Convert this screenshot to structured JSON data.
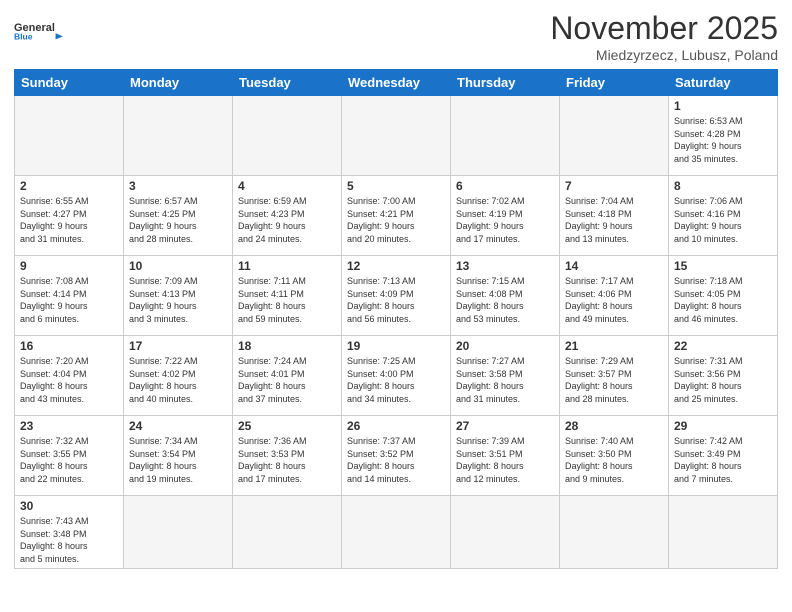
{
  "header": {
    "logo_general": "General",
    "logo_blue": "Blue",
    "month_year": "November 2025",
    "location": "Miedzyrzecz, Lubusz, Poland"
  },
  "weekdays": [
    "Sunday",
    "Monday",
    "Tuesday",
    "Wednesday",
    "Thursday",
    "Friday",
    "Saturday"
  ],
  "weeks": [
    [
      {
        "day": "",
        "info": ""
      },
      {
        "day": "",
        "info": ""
      },
      {
        "day": "",
        "info": ""
      },
      {
        "day": "",
        "info": ""
      },
      {
        "day": "",
        "info": ""
      },
      {
        "day": "",
        "info": ""
      },
      {
        "day": "1",
        "info": "Sunrise: 6:53 AM\nSunset: 4:28 PM\nDaylight: 9 hours\nand 35 minutes."
      }
    ],
    [
      {
        "day": "2",
        "info": "Sunrise: 6:55 AM\nSunset: 4:27 PM\nDaylight: 9 hours\nand 31 minutes."
      },
      {
        "day": "3",
        "info": "Sunrise: 6:57 AM\nSunset: 4:25 PM\nDaylight: 9 hours\nand 28 minutes."
      },
      {
        "day": "4",
        "info": "Sunrise: 6:59 AM\nSunset: 4:23 PM\nDaylight: 9 hours\nand 24 minutes."
      },
      {
        "day": "5",
        "info": "Sunrise: 7:00 AM\nSunset: 4:21 PM\nDaylight: 9 hours\nand 20 minutes."
      },
      {
        "day": "6",
        "info": "Sunrise: 7:02 AM\nSunset: 4:19 PM\nDaylight: 9 hours\nand 17 minutes."
      },
      {
        "day": "7",
        "info": "Sunrise: 7:04 AM\nSunset: 4:18 PM\nDaylight: 9 hours\nand 13 minutes."
      },
      {
        "day": "8",
        "info": "Sunrise: 7:06 AM\nSunset: 4:16 PM\nDaylight: 9 hours\nand 10 minutes."
      }
    ],
    [
      {
        "day": "9",
        "info": "Sunrise: 7:08 AM\nSunset: 4:14 PM\nDaylight: 9 hours\nand 6 minutes."
      },
      {
        "day": "10",
        "info": "Sunrise: 7:09 AM\nSunset: 4:13 PM\nDaylight: 9 hours\nand 3 minutes."
      },
      {
        "day": "11",
        "info": "Sunrise: 7:11 AM\nSunset: 4:11 PM\nDaylight: 8 hours\nand 59 minutes."
      },
      {
        "day": "12",
        "info": "Sunrise: 7:13 AM\nSunset: 4:09 PM\nDaylight: 8 hours\nand 56 minutes."
      },
      {
        "day": "13",
        "info": "Sunrise: 7:15 AM\nSunset: 4:08 PM\nDaylight: 8 hours\nand 53 minutes."
      },
      {
        "day": "14",
        "info": "Sunrise: 7:17 AM\nSunset: 4:06 PM\nDaylight: 8 hours\nand 49 minutes."
      },
      {
        "day": "15",
        "info": "Sunrise: 7:18 AM\nSunset: 4:05 PM\nDaylight: 8 hours\nand 46 minutes."
      }
    ],
    [
      {
        "day": "16",
        "info": "Sunrise: 7:20 AM\nSunset: 4:04 PM\nDaylight: 8 hours\nand 43 minutes."
      },
      {
        "day": "17",
        "info": "Sunrise: 7:22 AM\nSunset: 4:02 PM\nDaylight: 8 hours\nand 40 minutes."
      },
      {
        "day": "18",
        "info": "Sunrise: 7:24 AM\nSunset: 4:01 PM\nDaylight: 8 hours\nand 37 minutes."
      },
      {
        "day": "19",
        "info": "Sunrise: 7:25 AM\nSunset: 4:00 PM\nDaylight: 8 hours\nand 34 minutes."
      },
      {
        "day": "20",
        "info": "Sunrise: 7:27 AM\nSunset: 3:58 PM\nDaylight: 8 hours\nand 31 minutes."
      },
      {
        "day": "21",
        "info": "Sunrise: 7:29 AM\nSunset: 3:57 PM\nDaylight: 8 hours\nand 28 minutes."
      },
      {
        "day": "22",
        "info": "Sunrise: 7:31 AM\nSunset: 3:56 PM\nDaylight: 8 hours\nand 25 minutes."
      }
    ],
    [
      {
        "day": "23",
        "info": "Sunrise: 7:32 AM\nSunset: 3:55 PM\nDaylight: 8 hours\nand 22 minutes."
      },
      {
        "day": "24",
        "info": "Sunrise: 7:34 AM\nSunset: 3:54 PM\nDaylight: 8 hours\nand 19 minutes."
      },
      {
        "day": "25",
        "info": "Sunrise: 7:36 AM\nSunset: 3:53 PM\nDaylight: 8 hours\nand 17 minutes."
      },
      {
        "day": "26",
        "info": "Sunrise: 7:37 AM\nSunset: 3:52 PM\nDaylight: 8 hours\nand 14 minutes."
      },
      {
        "day": "27",
        "info": "Sunrise: 7:39 AM\nSunset: 3:51 PM\nDaylight: 8 hours\nand 12 minutes."
      },
      {
        "day": "28",
        "info": "Sunrise: 7:40 AM\nSunset: 3:50 PM\nDaylight: 8 hours\nand 9 minutes."
      },
      {
        "day": "29",
        "info": "Sunrise: 7:42 AM\nSunset: 3:49 PM\nDaylight: 8 hours\nand 7 minutes."
      }
    ],
    [
      {
        "day": "30",
        "info": "Sunrise: 7:43 AM\nSunset: 3:48 PM\nDaylight: 8 hours\nand 5 minutes."
      },
      {
        "day": "",
        "info": ""
      },
      {
        "day": "",
        "info": ""
      },
      {
        "day": "",
        "info": ""
      },
      {
        "day": "",
        "info": ""
      },
      {
        "day": "",
        "info": ""
      },
      {
        "day": "",
        "info": ""
      }
    ]
  ]
}
